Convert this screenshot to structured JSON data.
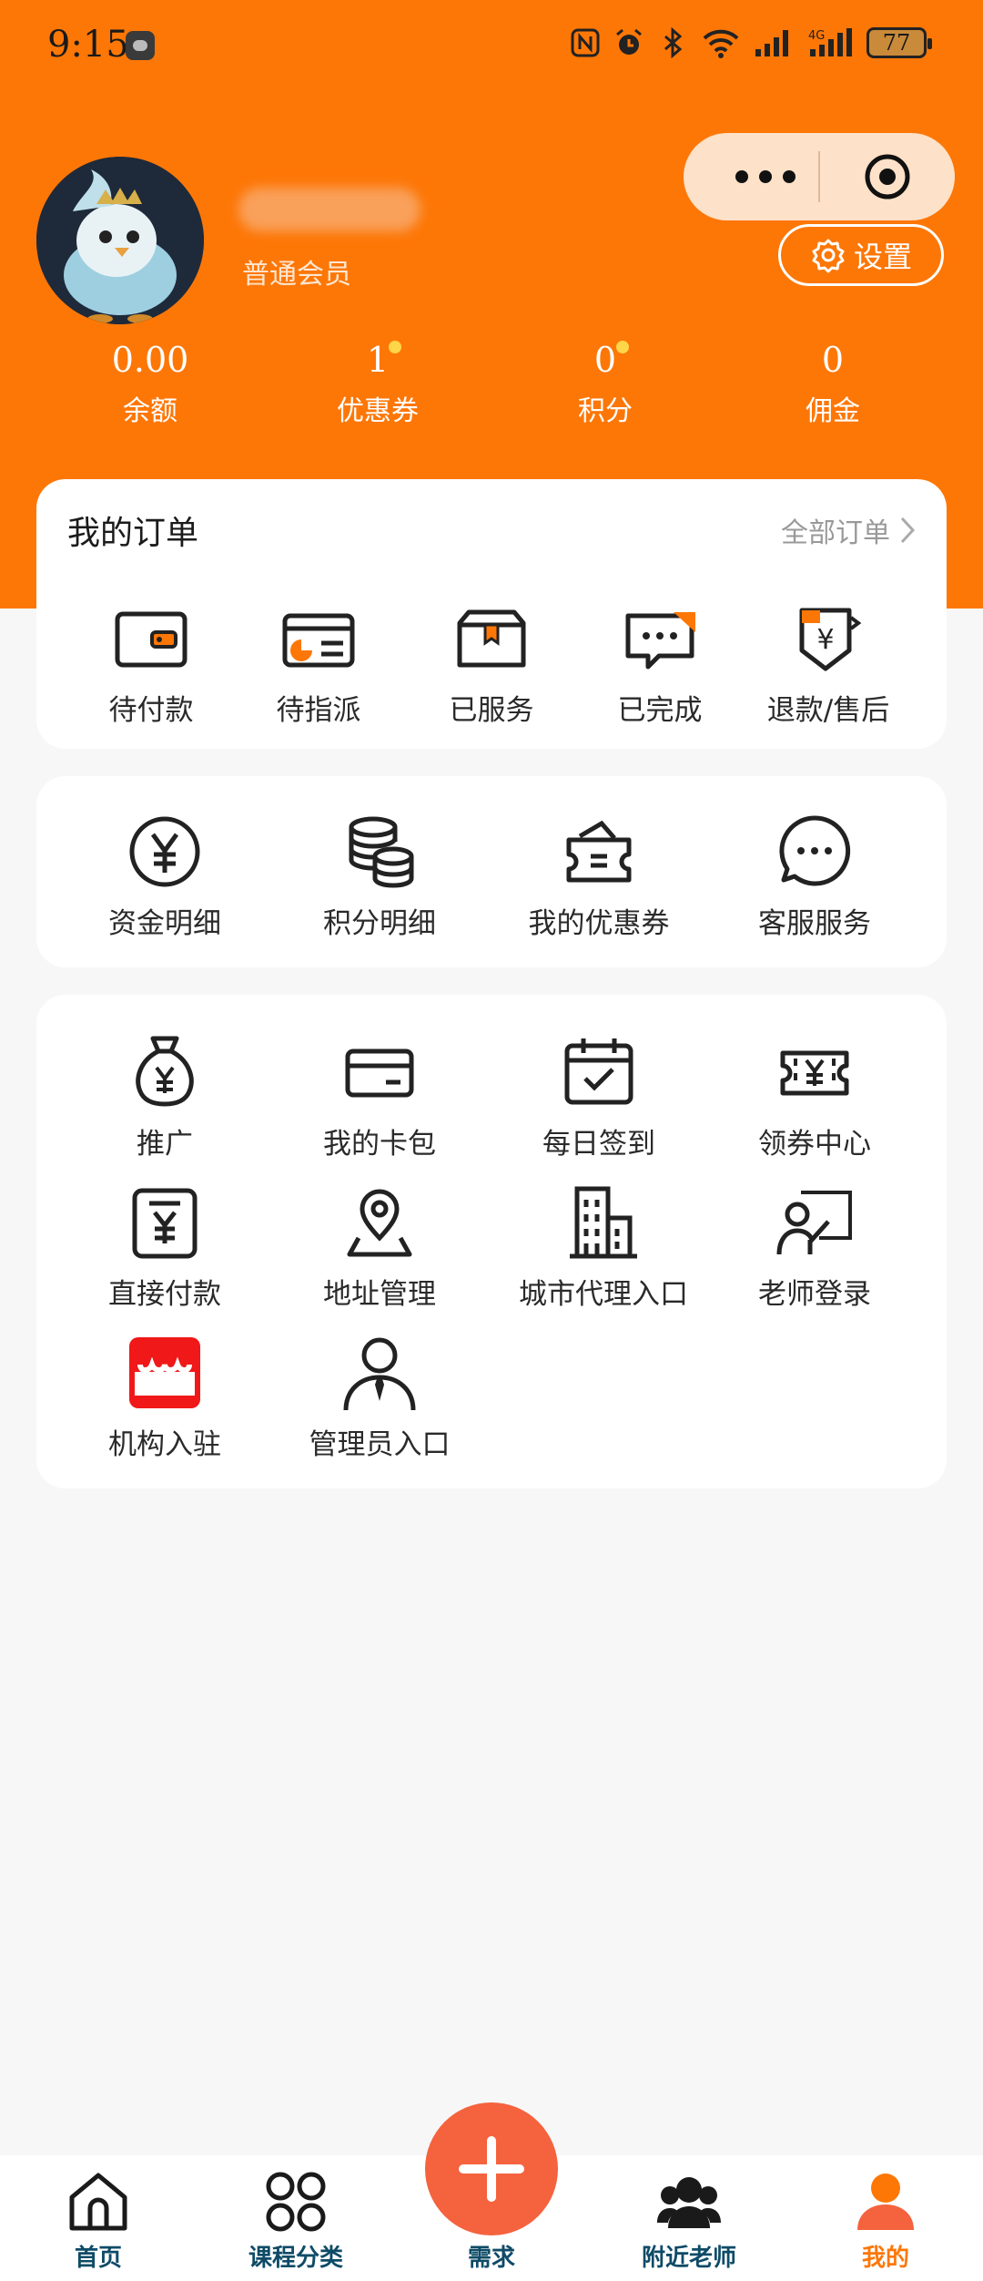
{
  "status_bar": {
    "time": "9:15",
    "battery": "77"
  },
  "colors": {
    "brand": "#fd7707",
    "accent_red": "#f5623e",
    "tab_text": "#0f4b67"
  },
  "profile": {
    "member_level": "普通会员",
    "settings_label": "设置"
  },
  "stats": [
    {
      "value": "0.00",
      "label": "余额",
      "dot": false
    },
    {
      "value": "1",
      "label": "优惠券",
      "dot": true
    },
    {
      "value": "0",
      "label": "积分",
      "dot": true
    },
    {
      "value": "0",
      "label": "佣金",
      "dot": false
    }
  ],
  "orders": {
    "title": "我的订单",
    "view_all": "全部订单",
    "items": [
      {
        "label": "待付款",
        "icon": "wallet-icon"
      },
      {
        "label": "待指派",
        "icon": "card-pie-icon"
      },
      {
        "label": "已服务",
        "icon": "box-icon"
      },
      {
        "label": "已完成",
        "icon": "chat-bubble-icon"
      },
      {
        "label": "退款/售后",
        "icon": "refund-shield-icon"
      }
    ]
  },
  "finance": {
    "items": [
      {
        "label": "资金明细",
        "icon": "yen-circle-icon"
      },
      {
        "label": "积分明细",
        "icon": "coin-stack-icon"
      },
      {
        "label": "我的优惠券",
        "icon": "coupon-wallet-icon"
      },
      {
        "label": "客服服务",
        "icon": "customer-service-icon"
      }
    ]
  },
  "tools": {
    "items": [
      {
        "label": "推广",
        "icon": "money-bag-icon"
      },
      {
        "label": "我的卡包",
        "icon": "card-icon"
      },
      {
        "label": "每日签到",
        "icon": "calendar-check-icon"
      },
      {
        "label": "领券中心",
        "icon": "ticket-icon"
      },
      {
        "label": "直接付款",
        "icon": "yen-receipt-icon"
      },
      {
        "label": "地址管理",
        "icon": "location-icon"
      },
      {
        "label": "城市代理入口",
        "icon": "building-icon"
      },
      {
        "label": "老师登录",
        "icon": "teacher-icon"
      },
      {
        "label": "机构入驻",
        "icon": "store-icon"
      },
      {
        "label": "管理员入口",
        "icon": "admin-icon"
      }
    ]
  },
  "tabbar": {
    "items": [
      {
        "label": "首页",
        "icon": "home-icon",
        "active": false
      },
      {
        "label": "课程分类",
        "icon": "grid-circles-icon",
        "active": false
      },
      {
        "label": "需求",
        "icon": "plus-icon",
        "active": false
      },
      {
        "label": "附近老师",
        "icon": "people-icon",
        "active": false
      },
      {
        "label": "我的",
        "icon": "user-icon",
        "active": true
      }
    ]
  }
}
